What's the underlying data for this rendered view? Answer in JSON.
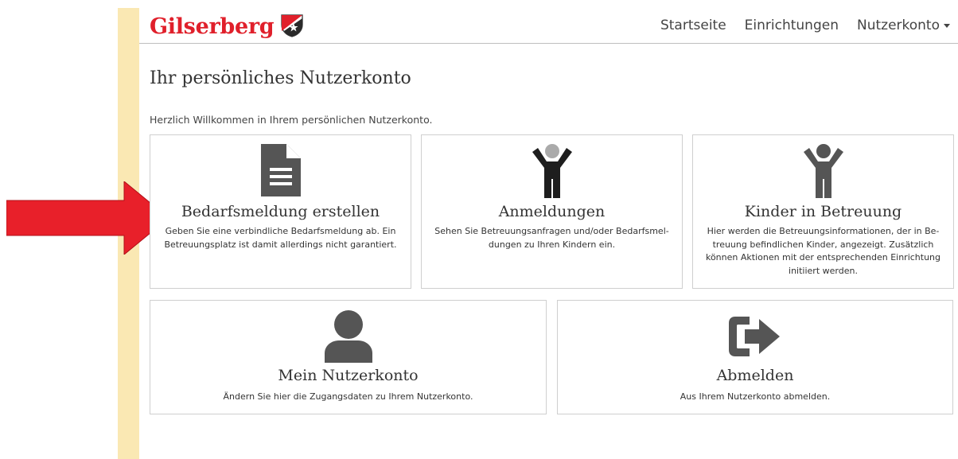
{
  "brand": {
    "name": "Gilserberg",
    "accent_color": "#e0202b"
  },
  "nav": {
    "items": [
      {
        "label": "Startseite"
      },
      {
        "label": "Einrichtungen"
      },
      {
        "label": "Nutzerkonto"
      }
    ]
  },
  "page": {
    "title": "Ihr persönliches Nutzerkonto",
    "welcome": "Herzlich Willkommen in Ihrem persönlichen Nutzerkonto."
  },
  "cards": [
    {
      "icon": "document-icon",
      "title": "Bedarfsmeldung erstellen",
      "description": "Geben Sie eine verbindliche Bedarfsmeldung ab. Ein Betreuungsplatz ist damit allerdings nicht garantiert."
    },
    {
      "icon": "child-icon",
      "title": "Anmeldungen",
      "description": "Sehen Sie Betreuungsanfragen und/oder Bedarfsmel-dungen zu Ihren Kindern ein."
    },
    {
      "icon": "child-icon",
      "title": "Kinder in Betreuung",
      "description": "Hier werden die Betreuungsinformationen, der in Be-treuung befindlichen Kinder, angezeigt. Zusätzlich können Aktionen mit der entsprechenden Einrichtung initiiert werden."
    },
    {
      "icon": "user-icon",
      "title": "Mein Nutzerkonto",
      "description": "Ändern Sie hier die Zugangsdaten zu Ihrem Nutzerkonto."
    },
    {
      "icon": "sign-out-icon",
      "title": "Abmelden",
      "description": "Aus Ihrem Nutzerkonto abmelden."
    }
  ],
  "annotation": {
    "icon": "red-arrow-icon",
    "color": "#e8202a"
  },
  "colors": {
    "sidebar_stripe": "#fae8b3",
    "icon_gray": "#555555"
  }
}
